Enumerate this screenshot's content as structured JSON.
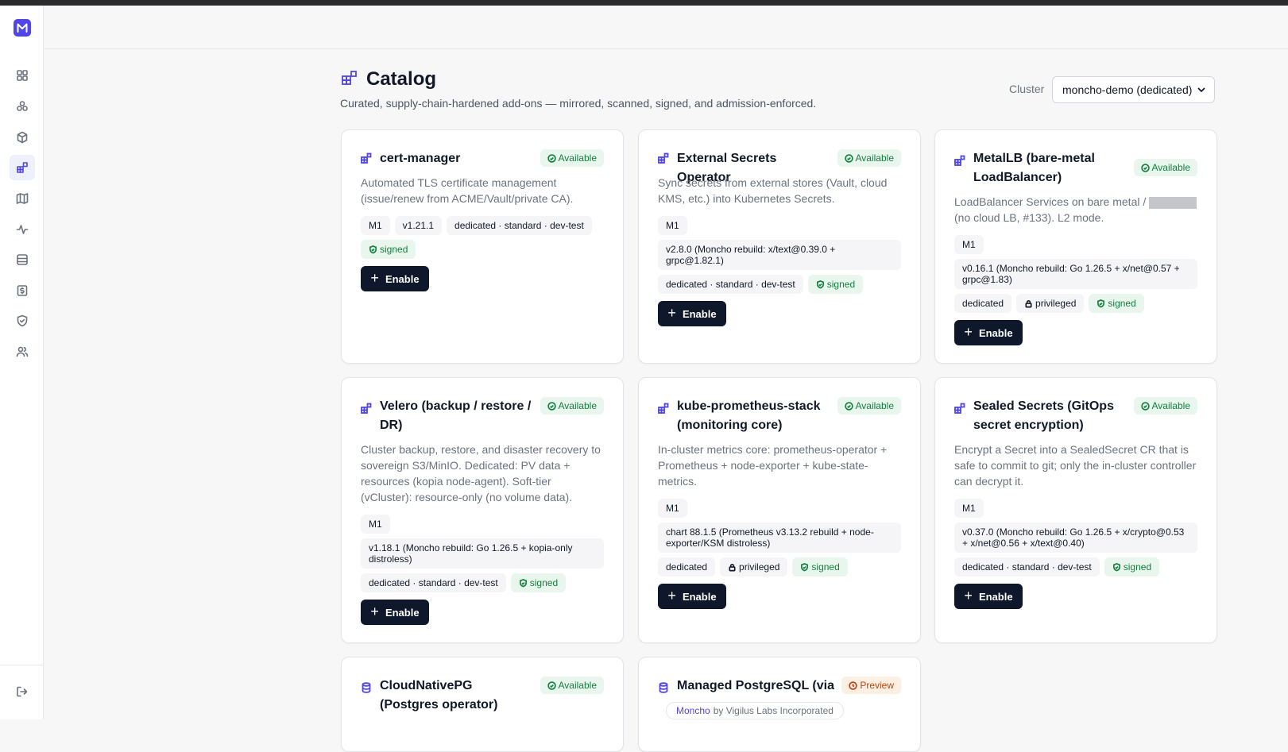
{
  "page": {
    "title": "Catalog",
    "subtitle": "Curated, supply-chain-hardened add-ons — mirrored, scanned, signed, and admission-enforced.",
    "cluster_label": "Cluster",
    "cluster_value": "moncho-demo (dedicated)"
  },
  "sidebar": {
    "items": [
      "dashboard-icon",
      "clusters-icon",
      "box-icon",
      "catalog-icon",
      "map-icon",
      "activity-icon",
      "storage-icon",
      "billing-icon",
      "shield-icon",
      "users-icon"
    ],
    "active": "catalog-icon",
    "logout": "logout-icon"
  },
  "colors": {
    "accent": "#4f46e5",
    "button": "#0f172a",
    "available": "#15803d",
    "preview": "#c2410c"
  },
  "cards": [
    {
      "title": "cert-manager",
      "status": "Available",
      "desc": "Automated TLS certificate management (issue/renew from ACME/Vault/private CA).",
      "tier": "M1",
      "version": "v1.21.1",
      "plans": "dedicated · standard · dev-test",
      "signed": "signed",
      "enable": "Enable"
    },
    {
      "title": "External Secrets Operator",
      "status": "Available",
      "desc": "Sync secrets from external stores (Vault, cloud KMS, etc.) into Kubernetes Secrets.",
      "tier": "M1",
      "version": "v2.8.0 (Moncho rebuild: x/text@0.39.0 + grpc@1.82.1)",
      "plans": "dedicated · standard · dev-test",
      "signed": "signed",
      "enable": "Enable"
    },
    {
      "title": "MetalLB (bare-metal LoadBalancer)",
      "status": "Available",
      "desc_a": "LoadBalancer Services on bare metal /",
      "desc_b": "(no cloud LB, #133). L2 mode.",
      "tier": "M1",
      "version": "v0.16.1 (Moncho rebuild: Go 1.26.5 + x/net@0.57 + grpc@1.83)",
      "plans": "dedicated",
      "privileged": "privileged",
      "signed": "signed",
      "enable": "Enable"
    },
    {
      "title": "Velero (backup / restore / DR)",
      "status": "Available",
      "desc": "Cluster backup, restore, and disaster recovery to sovereign S3/MinIO. Dedicated: PV data + resources (kopia node-agent). Soft-tier (vCluster): resource-only (no volume data).",
      "tier": "M1",
      "version": "v1.18.1 (Moncho rebuild: Go 1.26.5 + kopia-only distroless)",
      "plans": "dedicated · standard · dev-test",
      "signed": "signed",
      "enable": "Enable"
    },
    {
      "title": "kube-prometheus-stack (monitoring core)",
      "status": "Available",
      "desc": "In-cluster metrics core: prometheus-operator + Prometheus + node-exporter + kube-state-metrics.",
      "tier": "M1",
      "version": "chart 88.1.5 (Prometheus v3.13.2 rebuild + node-exporter/KSM distroless)",
      "plans": "dedicated",
      "privileged": "privileged",
      "signed": "signed",
      "enable": "Enable"
    },
    {
      "title": "Sealed Secrets (GitOps secret encryption)",
      "status": "Available",
      "desc": "Encrypt a Secret into a SealedSecret CR that is safe to commit to git; only the in-cluster controller can decrypt it.",
      "tier": "M1",
      "version": "v0.37.0 (Moncho rebuild: Go 1.26.5 + x/crypto@0.53 + x/net@0.56 + x/text@0.40)",
      "plans": "dedicated · standard · dev-test",
      "signed": "signed",
      "enable": "Enable"
    },
    {
      "title": "CloudNativePG (Postgres operator)",
      "status": "Available"
    },
    {
      "title": "Managed PostgreSQL (via",
      "status": "Preview",
      "vendor_brand": "Moncho",
      "vendor_rest": "by Vigilus Labs Incorporated"
    }
  ]
}
